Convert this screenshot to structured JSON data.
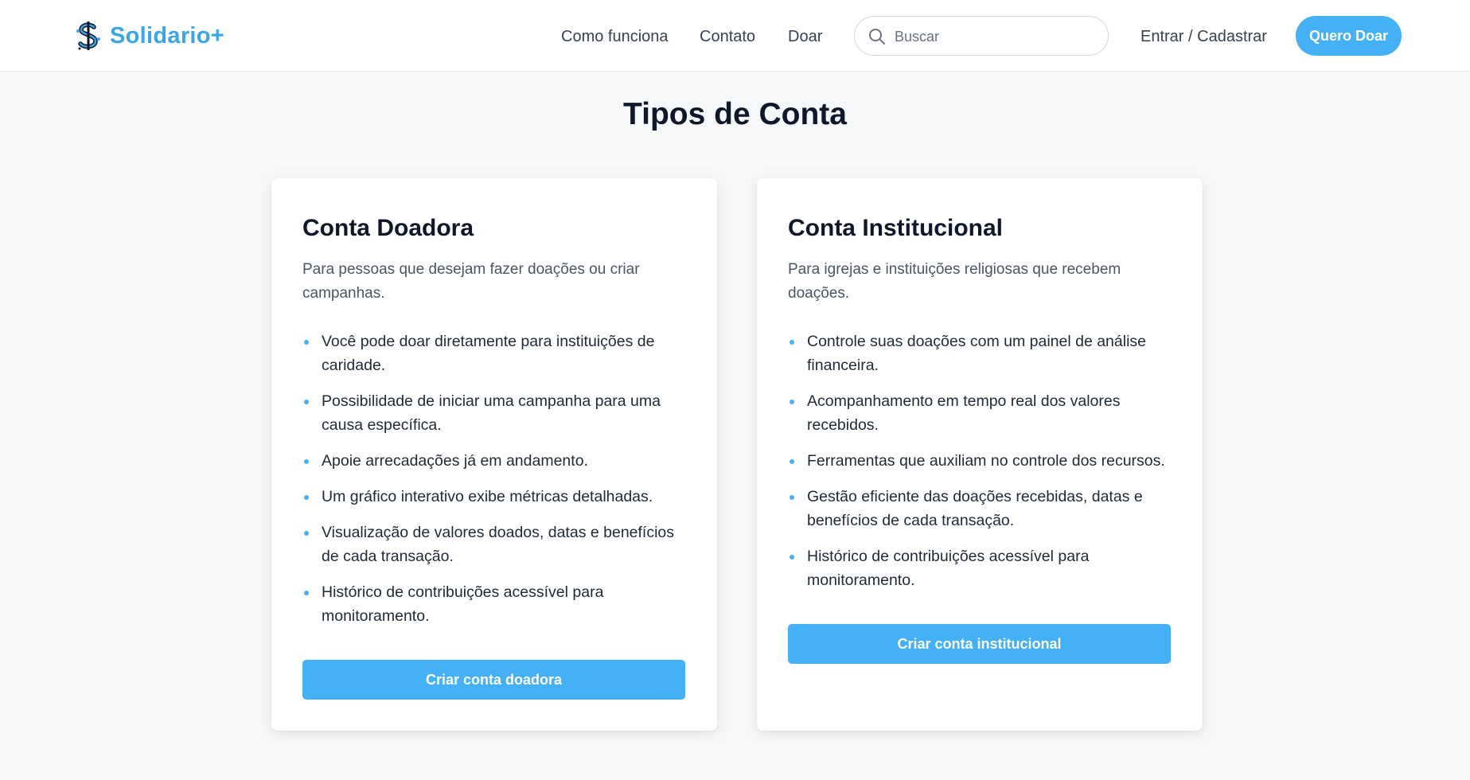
{
  "brand": {
    "name": "Solidario+",
    "accent": "#3aa6e8"
  },
  "nav": {
    "links": [
      "Como funciona",
      "Contato",
      "Doar"
    ],
    "search_placeholder": "Buscar",
    "login": "Entrar / Cadastrar",
    "cta": "Quero Doar"
  },
  "page": {
    "title": "Tipos de Conta"
  },
  "cards": [
    {
      "title": "Conta Doadora",
      "description": "Para pessoas que desejam fazer doações ou criar campanhas.",
      "items": [
        "Você pode doar diretamente para instituições de caridade.",
        "Possibilidade de iniciar uma campanha para uma causa específica.",
        "Apoie arrecadações já em andamento.",
        "Um gráfico interativo exibe métricas detalhadas.",
        "Visualização de valores doados, datas e benefícios de cada transação.",
        "Histórico de contribuições acessível para monitoramento."
      ],
      "button": "Criar conta doadora"
    },
    {
      "title": "Conta Institucional",
      "description": "Para igrejas e instituições religiosas que recebem doações.",
      "items": [
        "Controle suas doações com um painel de análise financeira.",
        "Acompanhamento em tempo real dos valores recebidos.",
        "Ferramentas que auxiliam no controle dos recursos.",
        "Gestão eficiente das doações recebidas, datas e benefícios de cada transação.",
        "Histórico de contribuições acessível para monitoramento."
      ],
      "button": "Criar conta institucional"
    }
  ],
  "icons": {
    "logo": "dollar-sign-logo-icon",
    "search": "search-icon"
  }
}
